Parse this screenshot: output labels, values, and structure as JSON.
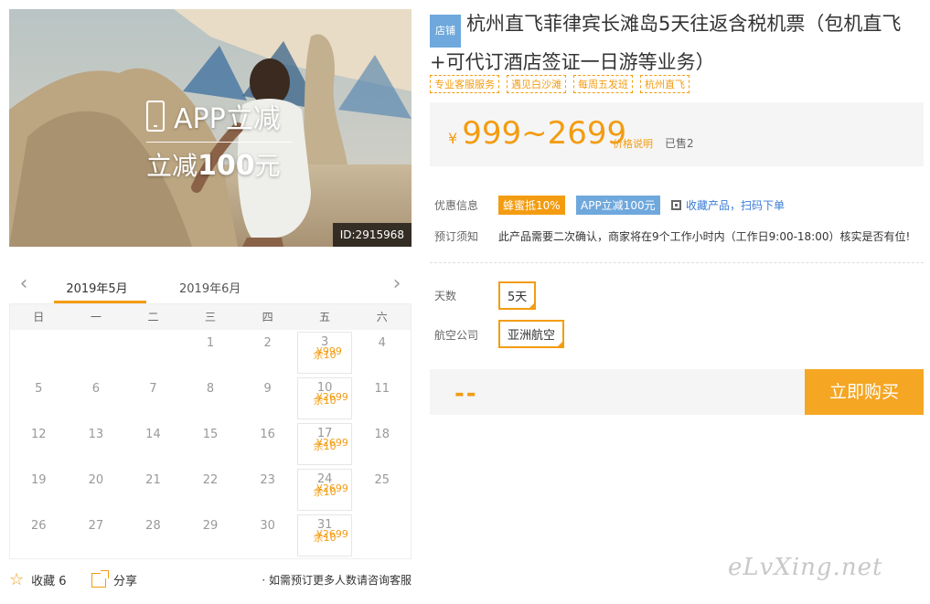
{
  "hero": {
    "app_label": "APP立减",
    "discount_prefix": "立减",
    "discount_amount": "100",
    "discount_suffix": "元",
    "id_badge": "ID:2915968"
  },
  "calendar": {
    "months": [
      "2019年5月",
      "2019年6月"
    ],
    "active_month": 0,
    "weekdays": [
      "日",
      "一",
      "二",
      "三",
      "四",
      "五",
      "六"
    ],
    "weeks": [
      [
        {
          "d": ""
        },
        {
          "d": ""
        },
        {
          "d": ""
        },
        {
          "d": "1"
        },
        {
          "d": "2"
        },
        {
          "d": "3",
          "price": "¥999",
          "stock": "余10"
        },
        {
          "d": "4"
        }
      ],
      [
        {
          "d": "5"
        },
        {
          "d": "6"
        },
        {
          "d": "7"
        },
        {
          "d": "8"
        },
        {
          "d": "9"
        },
        {
          "d": "10",
          "price": "¥2699",
          "stock": "余10"
        },
        {
          "d": "11"
        }
      ],
      [
        {
          "d": "12"
        },
        {
          "d": "13"
        },
        {
          "d": "14"
        },
        {
          "d": "15"
        },
        {
          "d": "16"
        },
        {
          "d": "17",
          "price": "¥2699",
          "stock": "余10"
        },
        {
          "d": "18"
        }
      ],
      [
        {
          "d": "19"
        },
        {
          "d": "20"
        },
        {
          "d": "21"
        },
        {
          "d": "22"
        },
        {
          "d": "23"
        },
        {
          "d": "24",
          "price": "¥2699",
          "stock": "余10"
        },
        {
          "d": "25"
        }
      ],
      [
        {
          "d": "26"
        },
        {
          "d": "27"
        },
        {
          "d": "28"
        },
        {
          "d": "29"
        },
        {
          "d": "30"
        },
        {
          "d": "31",
          "price": "¥2699",
          "stock": "余10"
        },
        {
          "d": ""
        }
      ]
    ]
  },
  "footer": {
    "favorite_label": "收藏 6",
    "share_label": "分享",
    "consult_text": "· 如需预订更多人数请咨询客服"
  },
  "product": {
    "shop_badge": "店铺",
    "title": "杭州直飞菲律宾长滩岛5天往返含税机票（包机直飞+可代订酒店签证一日游等业务）",
    "tags": [
      "专业客服服务",
      "遇见白沙滩",
      "每周五发班",
      "杭州直飞"
    ],
    "currency": "¥",
    "price_range": "999~2699",
    "price_note": "价格说明",
    "sold": "已售2"
  },
  "info": {
    "promo_label": "优惠信息",
    "promo_tags": [
      "蜂蜜抵10%",
      "APP立减100元"
    ],
    "qr_text": "收藏产品，扫码下单",
    "booking_label": "预订须知",
    "booking_text": "此产品需要二次确认，商家将在9个工作小时内（工作日9:00-18:00）核实是否有位!"
  },
  "options": {
    "days_label": "天数",
    "days_value": "5天",
    "airline_label": "航空公司",
    "airline_value": "亚洲航空"
  },
  "purchase": {
    "total": "--",
    "buy_label": "立即购买"
  },
  "watermark": "eLvXing.net",
  "colors": {
    "accent": "#f39c11",
    "blue": "#6fa8dc",
    "panel": "#f5f5f5"
  }
}
